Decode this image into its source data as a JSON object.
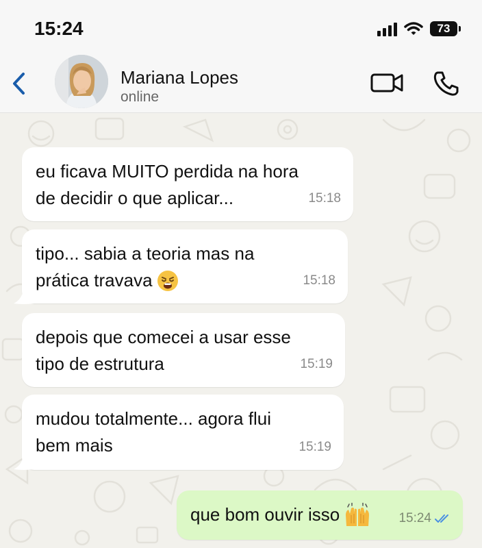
{
  "status_bar": {
    "time": "15:24",
    "battery": "73"
  },
  "contact": {
    "name": "Mariana Lopes",
    "presence": "online"
  },
  "icons": {
    "back": "chevron-left-icon",
    "video": "video-camera-icon",
    "call": "phone-icon",
    "read": "double-check-icon"
  },
  "colors": {
    "accent": "#1a5dab",
    "incoming": "#ffffff",
    "outgoing": "#dcf8c6",
    "read_receipt": "#4a90e2"
  },
  "messages": [
    {
      "direction": "in",
      "line1": "eu ficava MUITO perdida na hora",
      "line2": "de decidir o que aplicar...",
      "time": "15:18"
    },
    {
      "direction": "in",
      "line1": "tipo... sabia a teoria mas na",
      "line2": "prática travava",
      "emoji": "weary-face",
      "time": "15:18"
    },
    {
      "direction": "in",
      "line1": "depois que comecei a usar esse",
      "line2": "tipo de estrutura",
      "time": "15:19"
    },
    {
      "direction": "in",
      "line1": "mudou totalmente... agora flui",
      "line2": "bem mais",
      "time": "15:19"
    },
    {
      "direction": "out",
      "text": "que bom ouvir isso",
      "emoji": "raising-hands",
      "time": "15:24",
      "status": "read"
    }
  ]
}
